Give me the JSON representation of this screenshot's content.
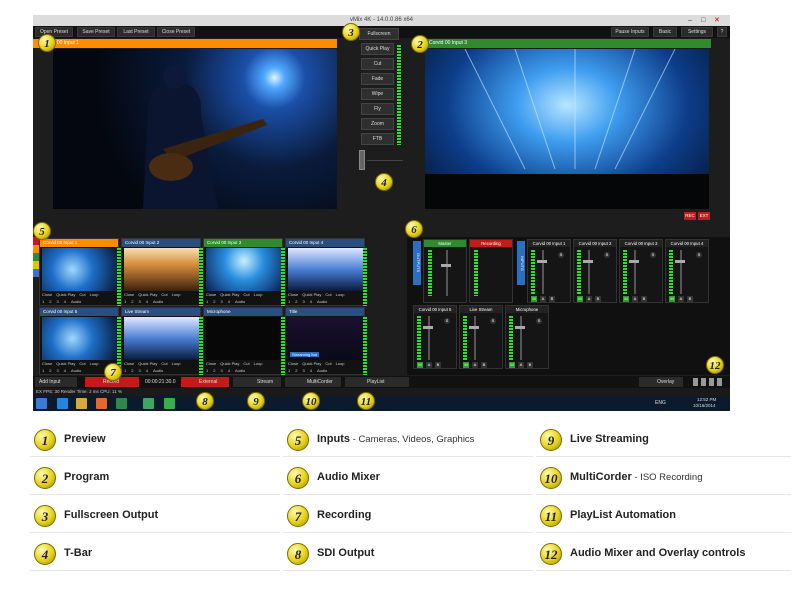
{
  "window": {
    "title": "vMix 4K - 14.0.0.86 x64",
    "minimize": "–",
    "maximize": "□",
    "close": "✕"
  },
  "toolbar": {
    "open_preset": "Open Preset",
    "save_preset": "Save Preset",
    "last_preset": "Last Preset",
    "close_preset": "Close Preset",
    "pause_inputs": "Pause Inputs",
    "basic": "Basic",
    "settings": "Settings",
    "help": "?"
  },
  "preview": {
    "title": "Corvid 00 Input 1"
  },
  "program": {
    "title": "Corvid 00 Input 3",
    "rec": "REC",
    "ext": "EXT"
  },
  "center": {
    "fullscreen": "Fullscreen",
    "buttons": [
      "Quick Play",
      "Cut",
      "Fade",
      "Wipe",
      "Fly",
      "Zoom",
      "FTB"
    ]
  },
  "inputs": [
    {
      "title": "Corvid 00 Input 1",
      "num": "1",
      "color": "#ff8c00",
      "thumb": "t-band"
    },
    {
      "title": "Corvid 00 Input 2",
      "num": "2",
      "color": "#2a4f7e",
      "thumb": "t-crowd"
    },
    {
      "title": "Corvid 00 Input 3",
      "num": "3",
      "color": "#2e8b2e",
      "thumb": "t-stage"
    },
    {
      "title": "Corvid 00 Input 4",
      "num": "4",
      "color": "#2a4f7e",
      "thumb": "t-stage2"
    },
    {
      "title": "Corvid 00 Input 5",
      "num": "5",
      "color": "#2a4f7e",
      "thumb": "t-band"
    },
    {
      "title": "Live Stream",
      "num": "6",
      "color": "#2a4f7e",
      "thumb": "t-stage2"
    },
    {
      "title": "Microphone",
      "num": "7",
      "color": "#2a4f7e",
      "thumb": "t-dark"
    },
    {
      "title": "Title",
      "num": "8",
      "color": "#2a4f7e",
      "thumb": "t-purple"
    }
  ],
  "tile_controls": [
    "Close",
    "Quick Play",
    "Cut",
    "Loop"
  ],
  "tile_numbers": [
    "1",
    "2",
    "3",
    "4",
    "Audio"
  ],
  "title_tile_text": "Streaming live",
  "mixer": {
    "master": "Master",
    "recording": "Recording",
    "outputs_label": "OUTPUTS",
    "inputs_label": "INPUTS",
    "channels": [
      "Corvid 00 Input 1",
      "Corvid 00 Input 2",
      "Corvid 00 Input 3",
      "Corvid 00 Input 4",
      "Corvid 00 Input 5",
      "Live Stream",
      "Microphone"
    ],
    "solo": "S",
    "m_btn": "M",
    "a_btn": "A",
    "b_btn": "B"
  },
  "bottom_bar": {
    "add_input": "Add Input",
    "record": "Record",
    "timecode": "00:00:21:30.0",
    "external": "External",
    "stream": "Stream",
    "multicorder": "MultiCorder",
    "playlist": "PlayList",
    "overlay": "Overlay"
  },
  "status": {
    "text": "EX  FPS: 30  Render Time: 2 ms  CPU: 11 %"
  },
  "taskbar": {
    "lang": "ENG",
    "time": "12:52 PM",
    "date": "10/16/2014"
  },
  "callouts": [
    "1",
    "2",
    "3",
    "4",
    "5",
    "6",
    "7",
    "8",
    "9",
    "10",
    "11",
    "12"
  ],
  "legend": [
    {
      "num": "1",
      "label": "Preview",
      "sub": ""
    },
    {
      "num": "2",
      "label": "Program",
      "sub": ""
    },
    {
      "num": "3",
      "label": "Fullscreen Output",
      "sub": ""
    },
    {
      "num": "4",
      "label": "T-Bar",
      "sub": ""
    },
    {
      "num": "5",
      "label": "Inputs",
      "sub": " - Cameras, Videos, Graphics"
    },
    {
      "num": "6",
      "label": "Audio Mixer",
      "sub": ""
    },
    {
      "num": "7",
      "label": "Recording",
      "sub": ""
    },
    {
      "num": "8",
      "label": "SDI Output",
      "sub": ""
    },
    {
      "num": "9",
      "label": "Live Streaming",
      "sub": ""
    },
    {
      "num": "10",
      "label": "MultiCorder",
      "sub": " - ISO Recording"
    },
    {
      "num": "11",
      "label": "PlayList Automation",
      "sub": ""
    },
    {
      "num": "12",
      "label": "Audio Mixer and Overlay controls",
      "sub": ""
    }
  ]
}
